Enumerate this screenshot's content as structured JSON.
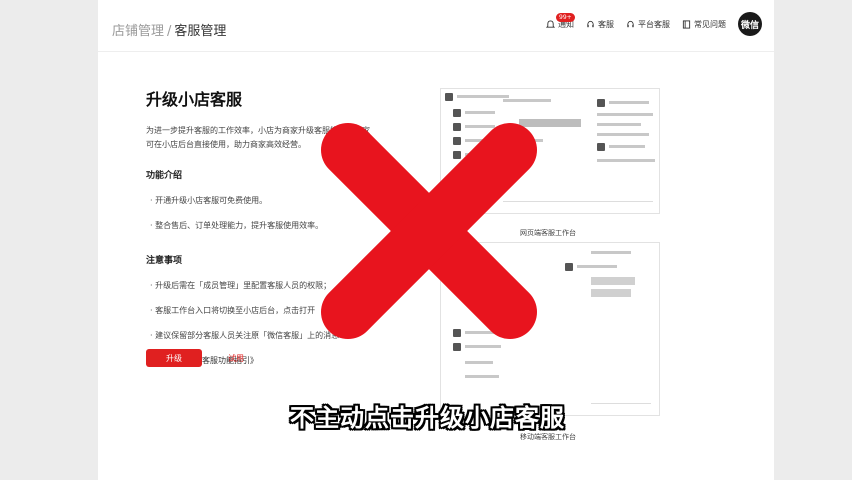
{
  "breadcrumb": {
    "parent": "店铺管理",
    "separator": "/",
    "current": "客服管理"
  },
  "nav": {
    "items": [
      {
        "label": "通知",
        "icon": "bell-icon",
        "badge": "99+"
      },
      {
        "label": "客服",
        "icon": "headset-icon"
      },
      {
        "label": "平台客服",
        "icon": "headset-icon"
      },
      {
        "label": "常见问题",
        "icon": "book-icon"
      }
    ],
    "avatar_text": "微信"
  },
  "main": {
    "title": "升级小店客服",
    "intro": "为进一步提升客服的工作效率，小店为商家升级客服能力，商家可在小店后台直接使用，助力商家高效经营。",
    "features_heading": "功能介绍",
    "features": [
      "开通升级小店客服可免费使用。",
      "整合售后、订单处理能力，提升客服使用效率。"
    ],
    "notes_heading": "注意事项",
    "notes": [
      "升级后需在「成员管理」里配置客服人员的权限；",
      "客服工作台入口将切换至小店后台，点击打开",
      "建议保留部分客服人员关注原「微信客服」上的消息"
    ],
    "guide_prefix": "详见",
    "guide_link": "《微信小店客服功能指引》",
    "upgrade_button": "升级",
    "trial_button": "试用"
  },
  "preview": {
    "web_caption": "网页端客服工作台",
    "mobile_caption": "移动端客服工作台"
  },
  "overlay": {
    "cross_color": "#e8141e",
    "subtitle": "不主动点击升级小店客服"
  },
  "colors": {
    "accent": "#e02020",
    "page_bg": "#ffffff",
    "outside_bg": "#ececec"
  }
}
